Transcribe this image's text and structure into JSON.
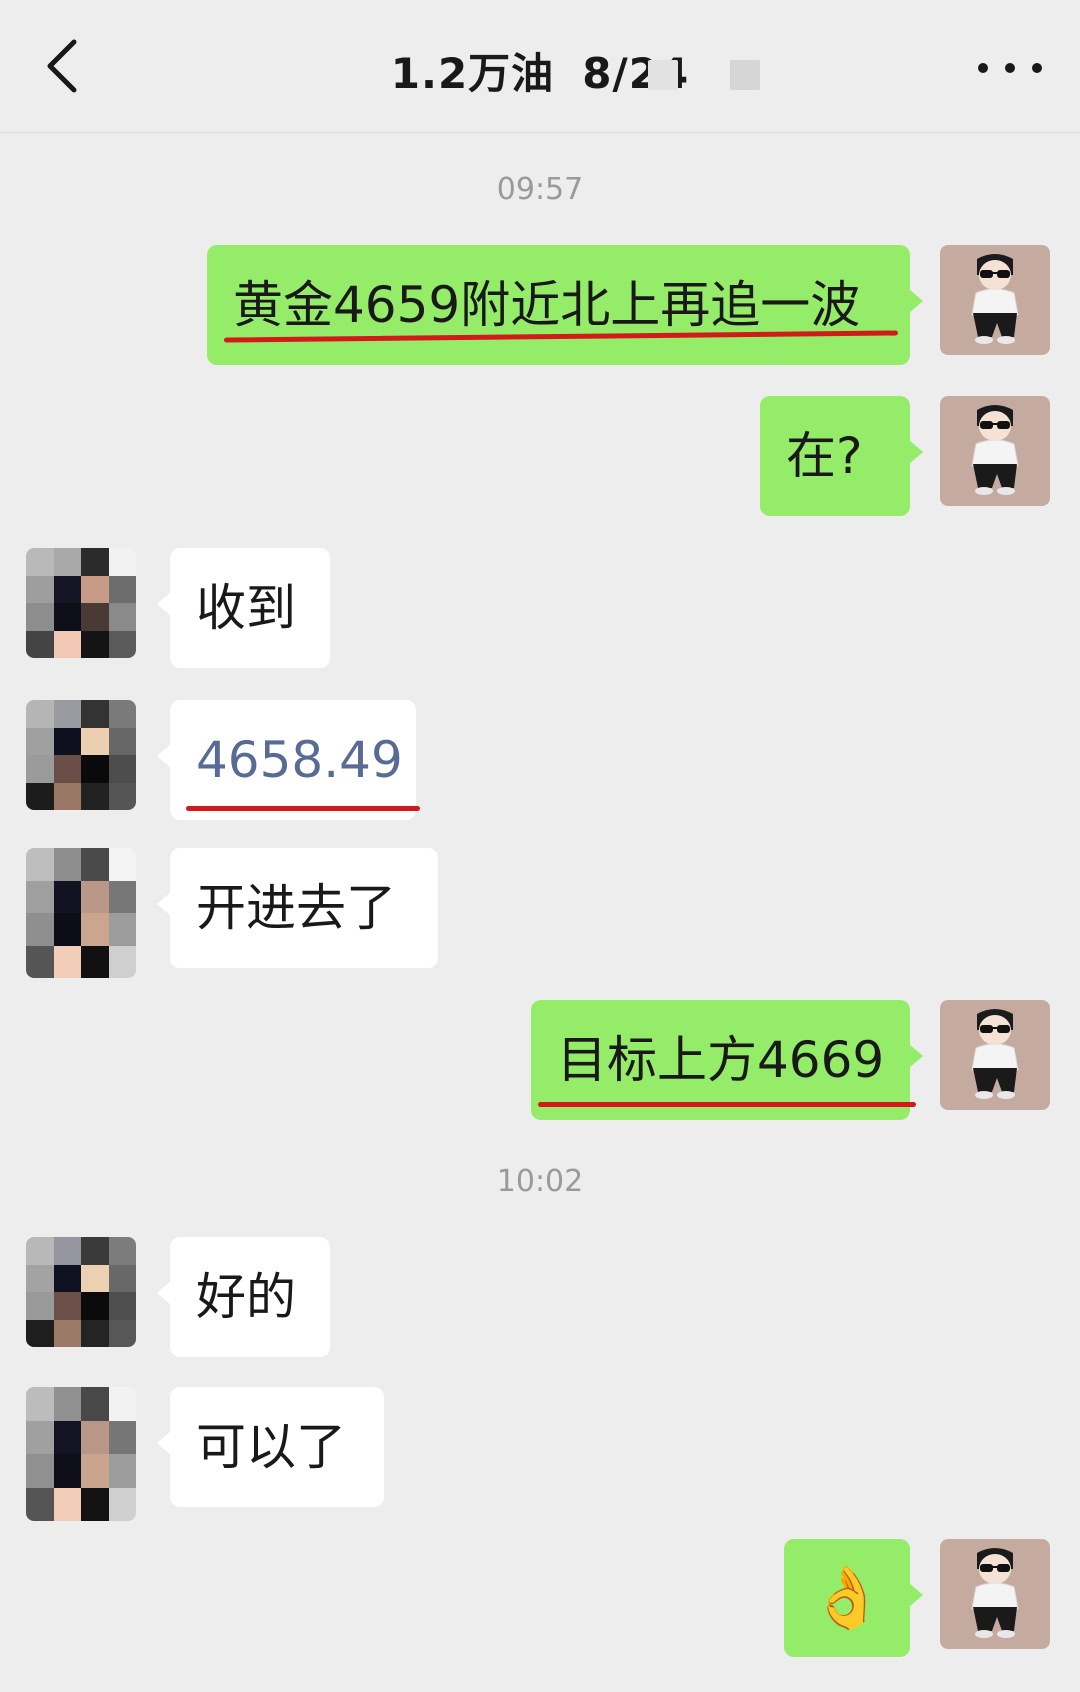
{
  "header": {
    "title": "1.2万油",
    "subtitle": "8/24"
  },
  "icons": {
    "back": "chevron-left-icon",
    "more": "more-dots-icon"
  },
  "colors": {
    "background": "#ededed",
    "outgoing_bubble": "#95ec69",
    "incoming_bubble": "#ffffff",
    "link_text": "#576b95",
    "highlight_underline": "#d21a1a"
  },
  "timestamps": [
    "09:57",
    "10:02"
  ],
  "messages": [
    {
      "sender": "me",
      "text": "黄金4659附近北上再追一波"
    },
    {
      "sender": "me",
      "text": "在?"
    },
    {
      "sender": "them",
      "text": "收到"
    },
    {
      "sender": "them",
      "text": "4658.49"
    },
    {
      "sender": "them",
      "text": "开进去了"
    },
    {
      "sender": "me",
      "text": "目标上方4669"
    },
    {
      "sender": "them",
      "text": "好的"
    },
    {
      "sender": "them",
      "text": "可以了"
    },
    {
      "sender": "me",
      "text": "👌"
    }
  ]
}
